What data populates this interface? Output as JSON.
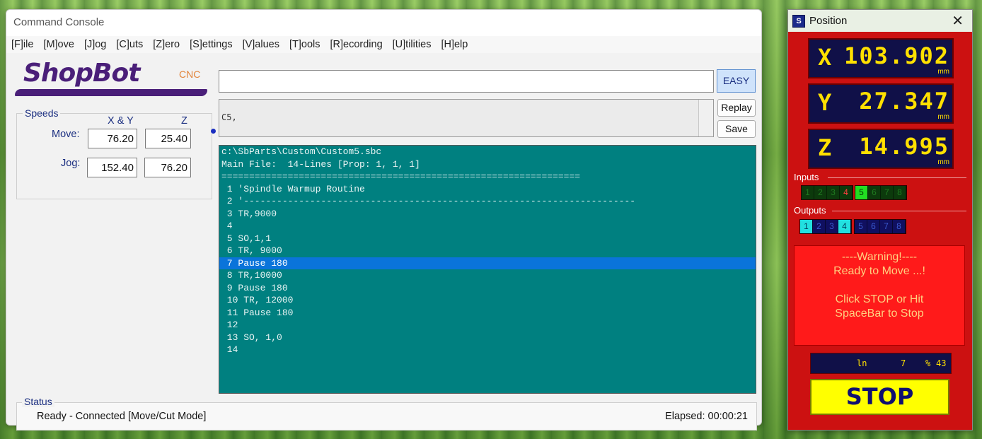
{
  "console": {
    "title": "Command Console",
    "menu": [
      "[F]ile",
      "[M]ove",
      "[J]og",
      "[C]uts",
      "[Z]ero",
      "[S]ettings",
      "[V]alues",
      "[T]ools",
      "[R]ecording",
      "[U]tilities",
      "[H]elp"
    ],
    "logo": {
      "text": "ShopBot",
      "sub": "CNC"
    },
    "speeds": {
      "legend": "Speeds",
      "col_xy": "X & Y",
      "col_z": "Z",
      "move_label": "Move:",
      "jog_label": "Jog:",
      "move_xy": "76.20",
      "move_z": "25.40",
      "jog_xy": "152.40",
      "jog_z": "76.20"
    },
    "command_input": "",
    "easy_label": "EASY",
    "history_text": "C5,",
    "replay_label": "Replay",
    "save_label": "Save",
    "file_path": "c:\\SbParts\\Custom\\Custom5.sbc",
    "main_file": "Main File:  14-Lines [Prop: 1, 1, 1]",
    "separator": "=================================================================",
    "code_lines": [
      " 1 'Spindle Warmup Routine",
      " 2 '-----------------------------------------------------------------------",
      " 3 TR,9000",
      " 4",
      " 5 SO,1,1",
      " 6 TR, 9000",
      " 7 Pause 180",
      " 8 TR,10000",
      " 9 Pause 180",
      " 10 TR, 12000",
      " 11 Pause 180",
      " 12",
      " 13 SO, 1,0",
      " 14"
    ],
    "highlighted_line": 7,
    "status": {
      "legend": "Status",
      "text": "Ready - Connected  [Move/Cut Mode]",
      "elapsed": "Elapsed: 00:00:21"
    }
  },
  "position": {
    "title": "Position",
    "close_icon": "close-icon",
    "x_label": "X",
    "x_value": "103.902",
    "y_label": "Y",
    "y_value": "27.347",
    "z_label": "Z",
    "z_value": "14.995",
    "unit": "mm",
    "inputs_label": "Inputs",
    "inputs": [
      {
        "n": "1",
        "on": false
      },
      {
        "n": "2",
        "on": false
      },
      {
        "n": "3",
        "on": false
      },
      {
        "n": "4",
        "on": false,
        "red": true
      },
      {
        "n": "5",
        "on": true
      },
      {
        "n": "6",
        "on": false
      },
      {
        "n": "7",
        "on": false
      },
      {
        "n": "8",
        "on": false
      }
    ],
    "outputs_label": "Outputs",
    "outputs": [
      {
        "n": "1",
        "on": true
      },
      {
        "n": "2",
        "on": false
      },
      {
        "n": "3",
        "on": false
      },
      {
        "n": "4",
        "on": true
      },
      {
        "n": "5",
        "on": false
      },
      {
        "n": "6",
        "on": false
      },
      {
        "n": "7",
        "on": false
      },
      {
        "n": "8",
        "on": false
      }
    ],
    "warning_line1": "----Warning!----",
    "warning_line2": "Ready to Move ...!",
    "warning_line3": "Click STOP or Hit",
    "warning_line4": "SpaceBar to Stop",
    "ln_label": "ln",
    "ln_value": "7",
    "pct_label": "%",
    "pct_value": "43",
    "stop_label": "STOP",
    "colors": {
      "panel": "#cc1111",
      "digits": "#ffe000",
      "readout_bg": "#101048",
      "stop": "#ffff00"
    }
  }
}
